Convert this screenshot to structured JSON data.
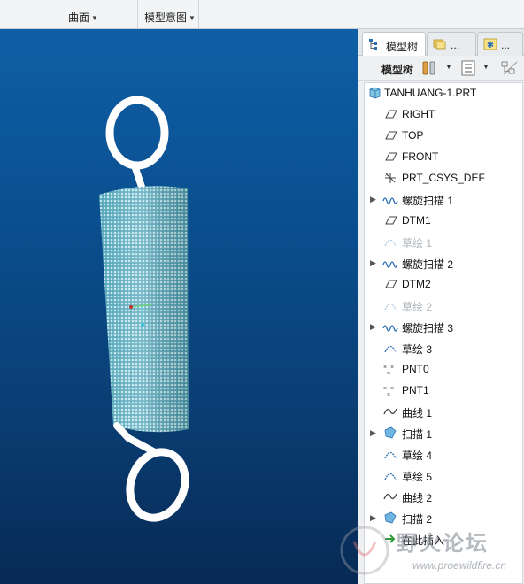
{
  "ribbon": {
    "groups": [
      {
        "label": "曲面"
      },
      {
        "label": "模型意图"
      }
    ]
  },
  "panel": {
    "tabs": [
      {
        "label": "模型树",
        "icon": "model-tree-icon"
      },
      {
        "label": "...",
        "icon": "layers-icon"
      },
      {
        "label": "...",
        "icon": "favorites-icon"
      }
    ],
    "toolbar": {
      "title": "模型树"
    },
    "tree": {
      "root": "TANHUANG-1.PRT",
      "items": [
        {
          "label": "RIGHT",
          "icon": "datum-plane-icon",
          "expandable": false,
          "dim": false
        },
        {
          "label": "TOP",
          "icon": "datum-plane-icon",
          "expandable": false,
          "dim": false
        },
        {
          "label": "FRONT",
          "icon": "datum-plane-icon",
          "expandable": false,
          "dim": false
        },
        {
          "label": "PRT_CSYS_DEF",
          "icon": "csys-icon",
          "expandable": false,
          "dim": false
        },
        {
          "label": "螺旋扫描 1",
          "icon": "helical-sweep-icon",
          "expandable": true,
          "dim": false
        },
        {
          "label": "DTM1",
          "icon": "datum-plane-icon",
          "expandable": false,
          "dim": false
        },
        {
          "label": "草绘 1",
          "icon": "sketch-icon",
          "expandable": false,
          "dim": true
        },
        {
          "label": "螺旋扫描 2",
          "icon": "helical-sweep-icon",
          "expandable": true,
          "dim": false
        },
        {
          "label": "DTM2",
          "icon": "datum-plane-icon",
          "expandable": false,
          "dim": false
        },
        {
          "label": "草绘 2",
          "icon": "sketch-icon",
          "expandable": false,
          "dim": true
        },
        {
          "label": "螺旋扫描 3",
          "icon": "helical-sweep-icon",
          "expandable": true,
          "dim": false
        },
        {
          "label": "草绘 3",
          "icon": "sketch-icon",
          "expandable": false,
          "dim": false
        },
        {
          "label": "PNT0",
          "icon": "datum-point-icon",
          "expandable": false,
          "dim": false
        },
        {
          "label": "PNT1",
          "icon": "datum-point-icon",
          "expandable": false,
          "dim": false
        },
        {
          "label": "曲线 1",
          "icon": "curve-icon",
          "expandable": false,
          "dim": false
        },
        {
          "label": "扫描 1",
          "icon": "sweep-icon",
          "expandable": true,
          "dim": false
        },
        {
          "label": "草绘 4",
          "icon": "sketch-icon",
          "expandable": false,
          "dim": false
        },
        {
          "label": "草绘 5",
          "icon": "sketch-icon",
          "expandable": false,
          "dim": false
        },
        {
          "label": "曲线 2",
          "icon": "curve-icon",
          "expandable": false,
          "dim": false
        },
        {
          "label": "扫描 2",
          "icon": "sweep-icon",
          "expandable": true,
          "dim": false
        },
        {
          "label": "在此插入",
          "icon": "insert-here-icon",
          "expandable": false,
          "dim": false
        }
      ]
    }
  },
  "watermark": {
    "title": "野火论坛",
    "url": "www.proewildfire.cn"
  },
  "colors": {
    "viewport_top": "#0f5fa6",
    "viewport_bottom": "#072a55",
    "spring_body": "#9fd4dc",
    "spring_hook": "#ffffff",
    "icon_blue": "#2a6fb5"
  }
}
